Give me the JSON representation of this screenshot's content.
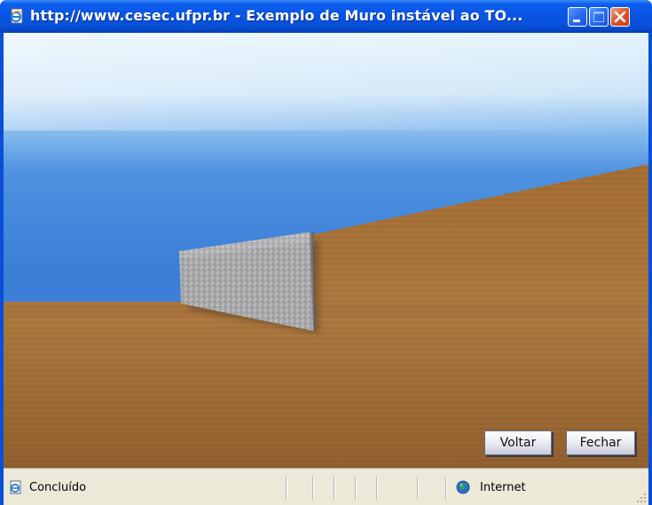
{
  "window": {
    "title": "http://www.cesec.ufpr.br - Exemplo de Muro instável ao TO...",
    "title_icon": "ie-page-icon"
  },
  "titlebar_buttons": {
    "minimize": "minimize-icon",
    "maximize": "maximize-icon",
    "close": "close-icon"
  },
  "scene": {
    "description_icon": "3d-scene",
    "colors": {
      "sky_top": "#2e6fd4",
      "sky_haze": "#d9eefc",
      "ground": "#a8743a",
      "wall": "#a9a9a9"
    }
  },
  "buttons": {
    "voltar_label": "Voltar",
    "fechar_label": "Fechar"
  },
  "status": {
    "text": "Concluído",
    "zone": "Internet",
    "status_icon": "ie-page-icon",
    "zone_icon": "globe-icon"
  }
}
